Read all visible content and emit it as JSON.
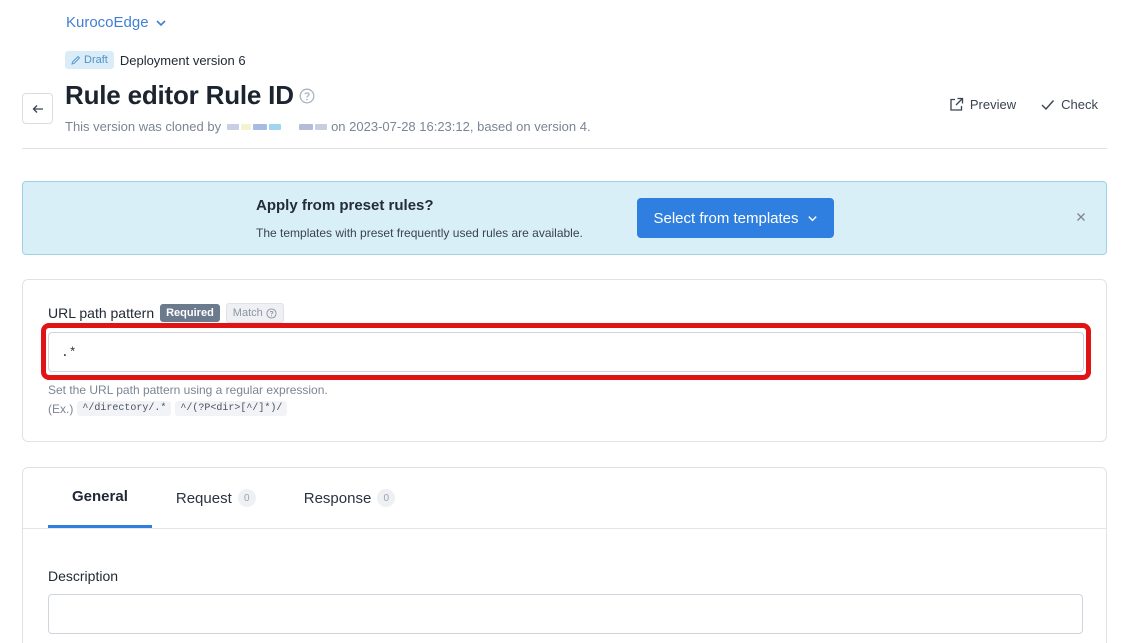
{
  "app": {
    "name": "KurocoEdge"
  },
  "version": {
    "status": "Draft",
    "label": "Deployment version 6"
  },
  "header": {
    "title": "Rule editor Rule ID",
    "clone_prefix": "This version was cloned by",
    "clone_suffix": "on 2023-07-28 16:23:12, based on version 4.",
    "preview_label": "Preview",
    "check_label": "Check"
  },
  "preset": {
    "title": "Apply from preset rules?",
    "subtitle": "The templates with preset frequently used rules are available.",
    "button_label": "Select from templates"
  },
  "url_pattern": {
    "label": "URL path pattern",
    "required_badge": "Required",
    "match_badge": "Match",
    "value": ".*",
    "hint": "Set the URL path pattern using a regular expression.",
    "example_prefix": "(Ex.)",
    "examples": [
      "^/directory/.*",
      "^/(?P<dir>[^/]*)/"
    ]
  },
  "tabs": [
    {
      "label": "General",
      "count": ""
    },
    {
      "label": "Request",
      "count": "0"
    },
    {
      "label": "Response",
      "count": "0"
    }
  ],
  "general": {
    "description_label": "Description",
    "description_value": ""
  },
  "colors": {
    "accent": "#2f7fe0",
    "highlight": "#e01414",
    "banner_bg": "#d9eff8"
  },
  "icons": {
    "app_switch": "chevron-down-icon",
    "draft": "pencil-icon",
    "back": "arrow-left-icon",
    "help": "question-circle-icon",
    "preview": "external-link-icon",
    "check": "check-icon",
    "close": "close-icon"
  }
}
